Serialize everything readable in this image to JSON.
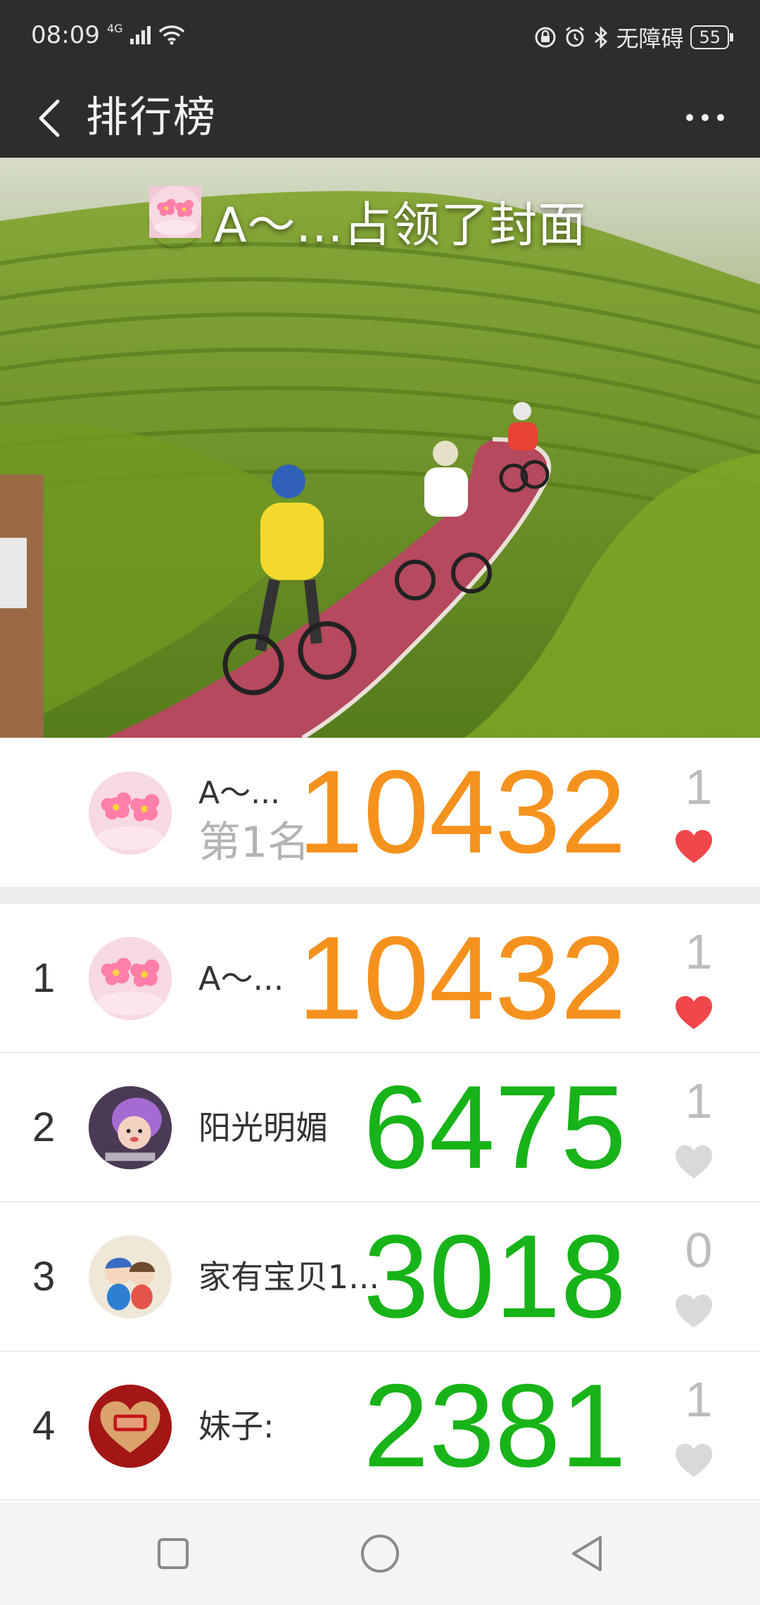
{
  "status_bar": {
    "time": "08:09",
    "network": "4G",
    "accessibility": "无障碍",
    "battery": "55"
  },
  "header": {
    "title": "排行榜",
    "back_icon": "chevron-left-icon",
    "more_icon": "more-dots-icon"
  },
  "cover": {
    "caption": "A～...占领了封面"
  },
  "my_entry": {
    "name": "A～...",
    "rank_label": "第1名",
    "steps": "10432",
    "likes": "1",
    "liked": true
  },
  "ranking": [
    {
      "rank": "1",
      "name": "A～...",
      "steps": "10432",
      "likes": "1",
      "liked": true,
      "color": "#f5921e"
    },
    {
      "rank": "2",
      "name": "阳光明媚",
      "steps": "6475",
      "likes": "1",
      "liked": false,
      "color": "#17b318"
    },
    {
      "rank": "3",
      "name": "家有宝贝1...",
      "steps": "3018",
      "likes": "0",
      "liked": false,
      "color": "#17b318"
    },
    {
      "rank": "4",
      "name": "妹子:",
      "steps": "2381",
      "likes": "1",
      "liked": false,
      "color": "#17b318"
    }
  ],
  "colors": {
    "header_bg": "#2d2d2d",
    "first_place_score": "#f5921e",
    "other_score": "#17b318",
    "heart_active": "#f0474a",
    "heart_inactive": "#d9d9d9"
  }
}
